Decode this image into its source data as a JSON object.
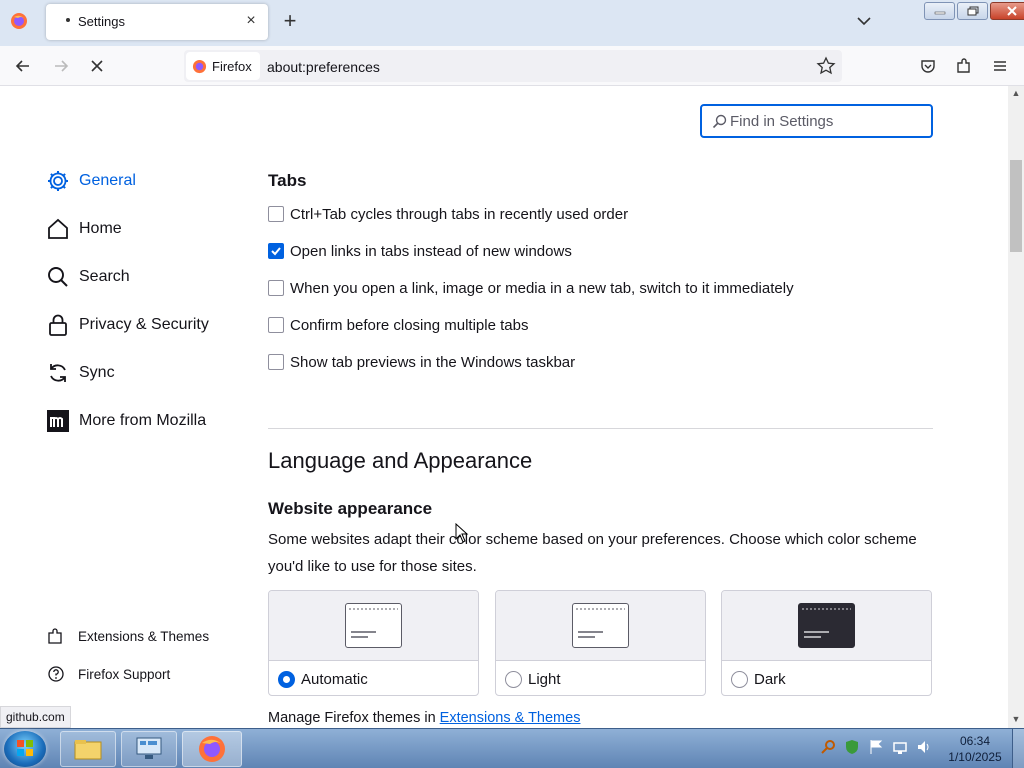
{
  "browser": {
    "tab": {
      "title": "Settings"
    },
    "url": {
      "identity_label": "Firefox",
      "address": "about:preferences"
    }
  },
  "settings": {
    "search_placeholder": "Find in Settings",
    "sidebar": {
      "items": [
        {
          "label": "General",
          "icon": "gear-icon",
          "selected": true
        },
        {
          "label": "Home",
          "icon": "home-icon"
        },
        {
          "label": "Search",
          "icon": "search-icon"
        },
        {
          "label": "Privacy & Security",
          "icon": "lock-icon"
        },
        {
          "label": "Sync",
          "icon": "sync-icon"
        },
        {
          "label": "More from Mozilla",
          "icon": "mozilla-icon"
        }
      ],
      "footer": [
        {
          "label": "Extensions & Themes",
          "icon": "puzzle-icon"
        },
        {
          "label": "Firefox Support",
          "icon": "help-icon"
        }
      ]
    },
    "tabs_section": {
      "heading": "Tabs",
      "options": [
        {
          "label": "Ctrl+Tab cycles through tabs in recently used order",
          "checked": false
        },
        {
          "label": "Open links in tabs instead of new windows",
          "checked": true
        },
        {
          "label": "When you open a link, image or media in a new tab, switch to it immediately",
          "checked": false
        },
        {
          "label": "Confirm before closing multiple tabs",
          "checked": false
        },
        {
          "label": "Show tab previews in the Windows taskbar",
          "checked": false
        }
      ]
    },
    "language_heading": "Language and Appearance",
    "website_appearance": {
      "heading": "Website appearance",
      "description": "Some websites adapt their color scheme based on your preferences. Choose which color scheme you'd like to use for those sites.",
      "schemes": [
        {
          "label": "Automatic",
          "selected": true
        },
        {
          "label": "Light",
          "selected": false
        },
        {
          "label": "Dark",
          "selected": false
        }
      ],
      "manage_prefix": "Manage Firefox themes in",
      "manage_link": "Extensions & Themes"
    },
    "status_url": "github.com"
  },
  "taskbar": {
    "time": "06:34",
    "date": "1/10/2025"
  },
  "colors": {
    "accent": "#0061e0",
    "tabbar": "#dce6f3"
  }
}
